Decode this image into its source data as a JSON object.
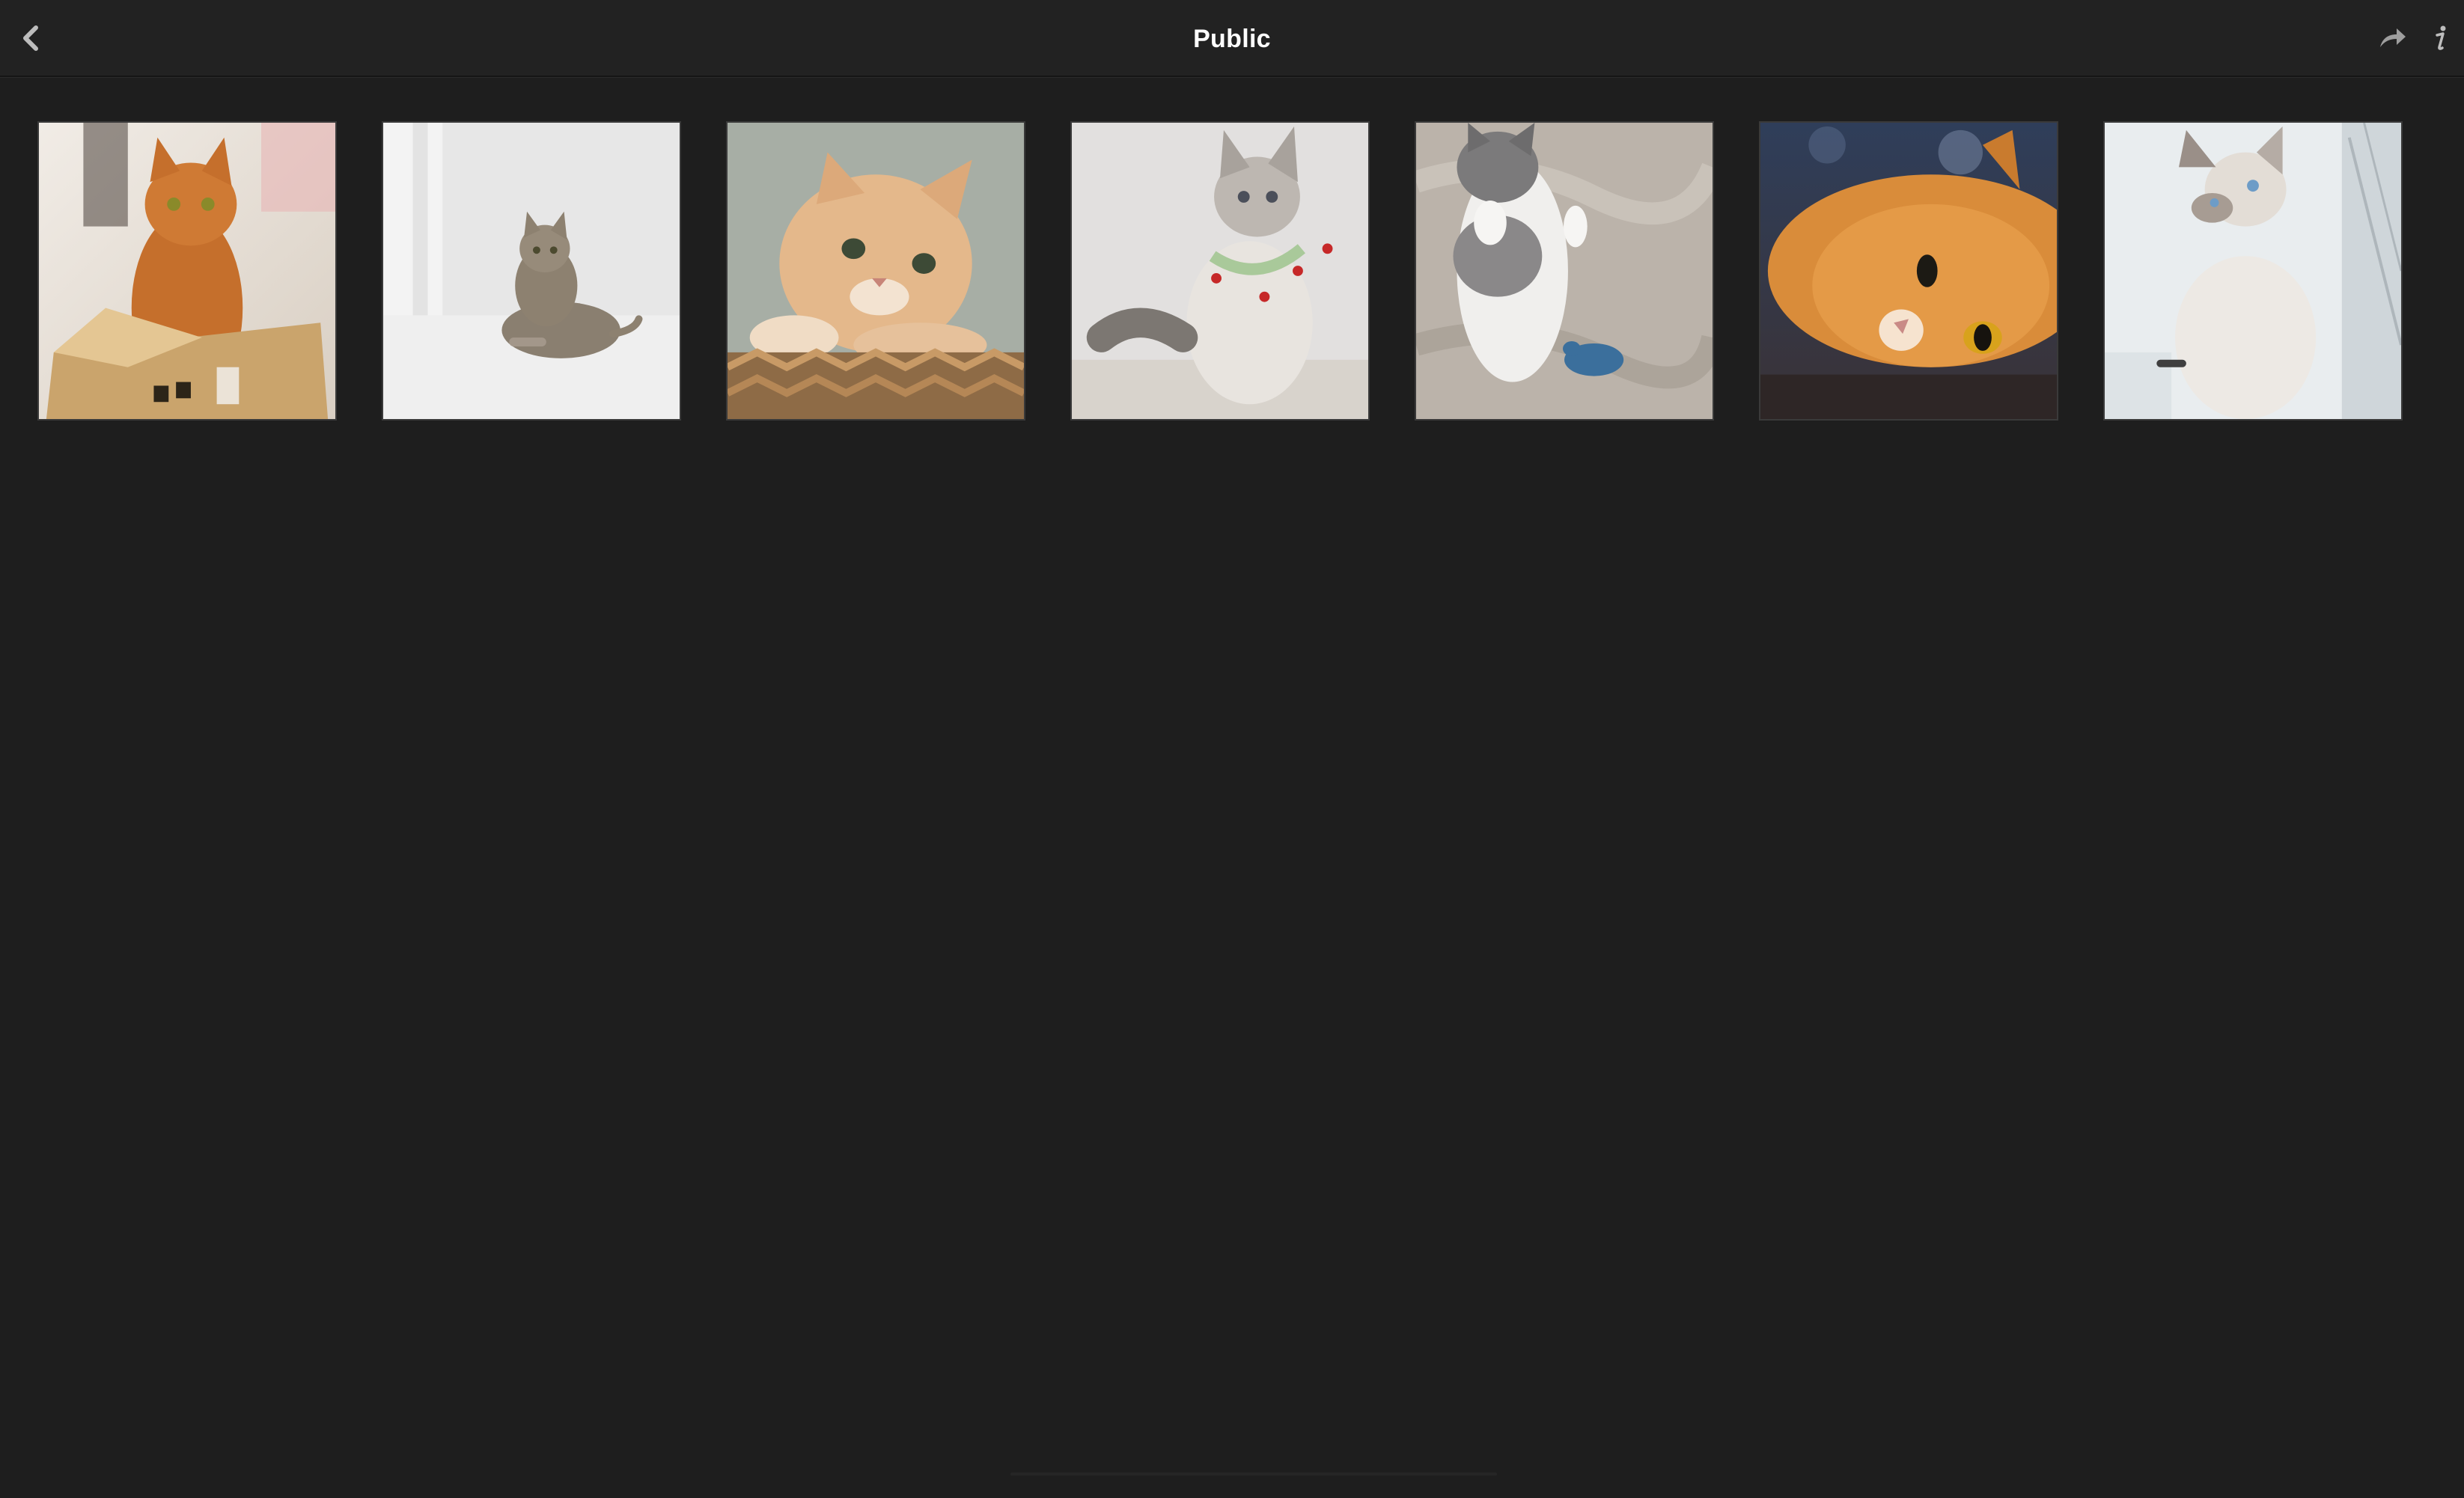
{
  "window": {
    "title": "Public"
  },
  "toolbar": {
    "back_icon": "chevron-left-icon",
    "share_icon": "share-arrow-icon",
    "info_icon": "info-icon"
  },
  "album": {
    "photos": [
      {
        "subject": "orange-cat-in-box",
        "colors": {
          "bg": "#e9e2d8",
          "fur": "#c9742f"
        }
      },
      {
        "subject": "tabby-cat-lying-white-floor",
        "colors": {
          "bg": "#e6e6e6",
          "fur": "#8d8170"
        }
      },
      {
        "subject": "cream-cat-on-wicker-basket",
        "colors": {
          "bg": "#a9b0a8",
          "fur": "#e2b589"
        }
      },
      {
        "subject": "fluffy-grey-cat-with-collar",
        "colors": {
          "bg": "#e3e1e0",
          "fur": "#d8d2cc"
        }
      },
      {
        "subject": "grey-white-kitten-sleeping-with-toy",
        "colors": {
          "bg": "#bdb6ad",
          "fur": "#f1f0ee"
        }
      },
      {
        "subject": "orange-fluffy-cat-lying",
        "colors": {
          "bg": "#3f4a5c",
          "fur": "#d88c3b"
        }
      },
      {
        "subject": "siamese-kitten-by-window",
        "colors": {
          "bg": "#e8ecee",
          "fur": "#ece8e2"
        }
      }
    ]
  },
  "theme": {
    "background": "#1e1e1e",
    "toolbar": "#222222",
    "icon": "#bdbdbd",
    "title": "#ffffff"
  }
}
